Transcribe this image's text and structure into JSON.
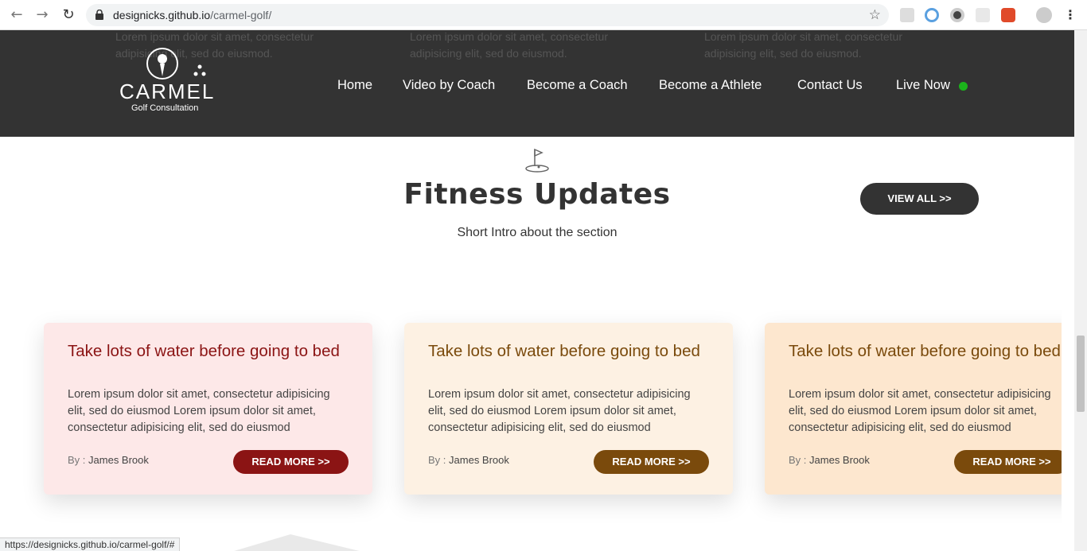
{
  "browser": {
    "url_host": "designicks.github.io",
    "url_path": "/carmel-golf/",
    "status_url": "https://designicks.github.io/carmel-golf/#"
  },
  "header": {
    "peek_texts": [
      "Lorem ipsum dolor sit amet, consectetur adipisicing elit, sed do eiusmod.",
      "Lorem ipsum dolor sit amet, consectetur adipisicing elit, sed do eiusmod.",
      "Lorem ipsum dolor sit amet, consectetur adipisicing elit, sed do eiusmod."
    ],
    "logo_name": "CARMEL",
    "logo_sub": "Golf Consultation",
    "nav": [
      "Home",
      "Video by Coach",
      "Become a Coach",
      "Become a Athlete",
      "Contact Us",
      "Live Now"
    ],
    "live_color": "#1bb31b"
  },
  "section": {
    "title": "Fitness Updates",
    "intro": "Short Intro about the section",
    "view_all": "VIEW ALL >>"
  },
  "cards": [
    {
      "title": "Take lots of water before going to bed",
      "text_lines": [
        "Lorem ipsum dolor sit amet, consectetur adipisicing",
        "elit, sed do eiusmod Lorem ipsum dolor sit amet,",
        "consectetur adipisicing elit, sed do eiusmod"
      ],
      "by": "By :",
      "author": "James Brook",
      "button": "READ MORE >>",
      "bg": "#fde8e8",
      "accent": "#8b1414"
    },
    {
      "title": "Take lots of water before going to bed",
      "text_lines": [
        "Lorem ipsum dolor sit amet, consectetur adipisicing",
        "elit, sed do eiusmod Lorem ipsum dolor sit amet,",
        "consectetur adipisicing elit, sed do eiusmod"
      ],
      "by": "By :",
      "author": "James Brook",
      "button": "READ MORE >>",
      "bg": "#fdf1e3",
      "accent": "#7a4a0c"
    },
    {
      "title": "Take lots of water before going to bed",
      "text_lines": [
        "Lorem ipsum dolor sit amet, consectetur adipisicing",
        "elit, sed do eiusmod Lorem ipsum dolor sit amet,",
        "consectetur adipisicing elit, sed do eiusmod"
      ],
      "by": "By :",
      "author": "James Brook",
      "button": "READ MORE >>",
      "bg": "#fde7cf",
      "accent": "#7a4a0c"
    }
  ]
}
